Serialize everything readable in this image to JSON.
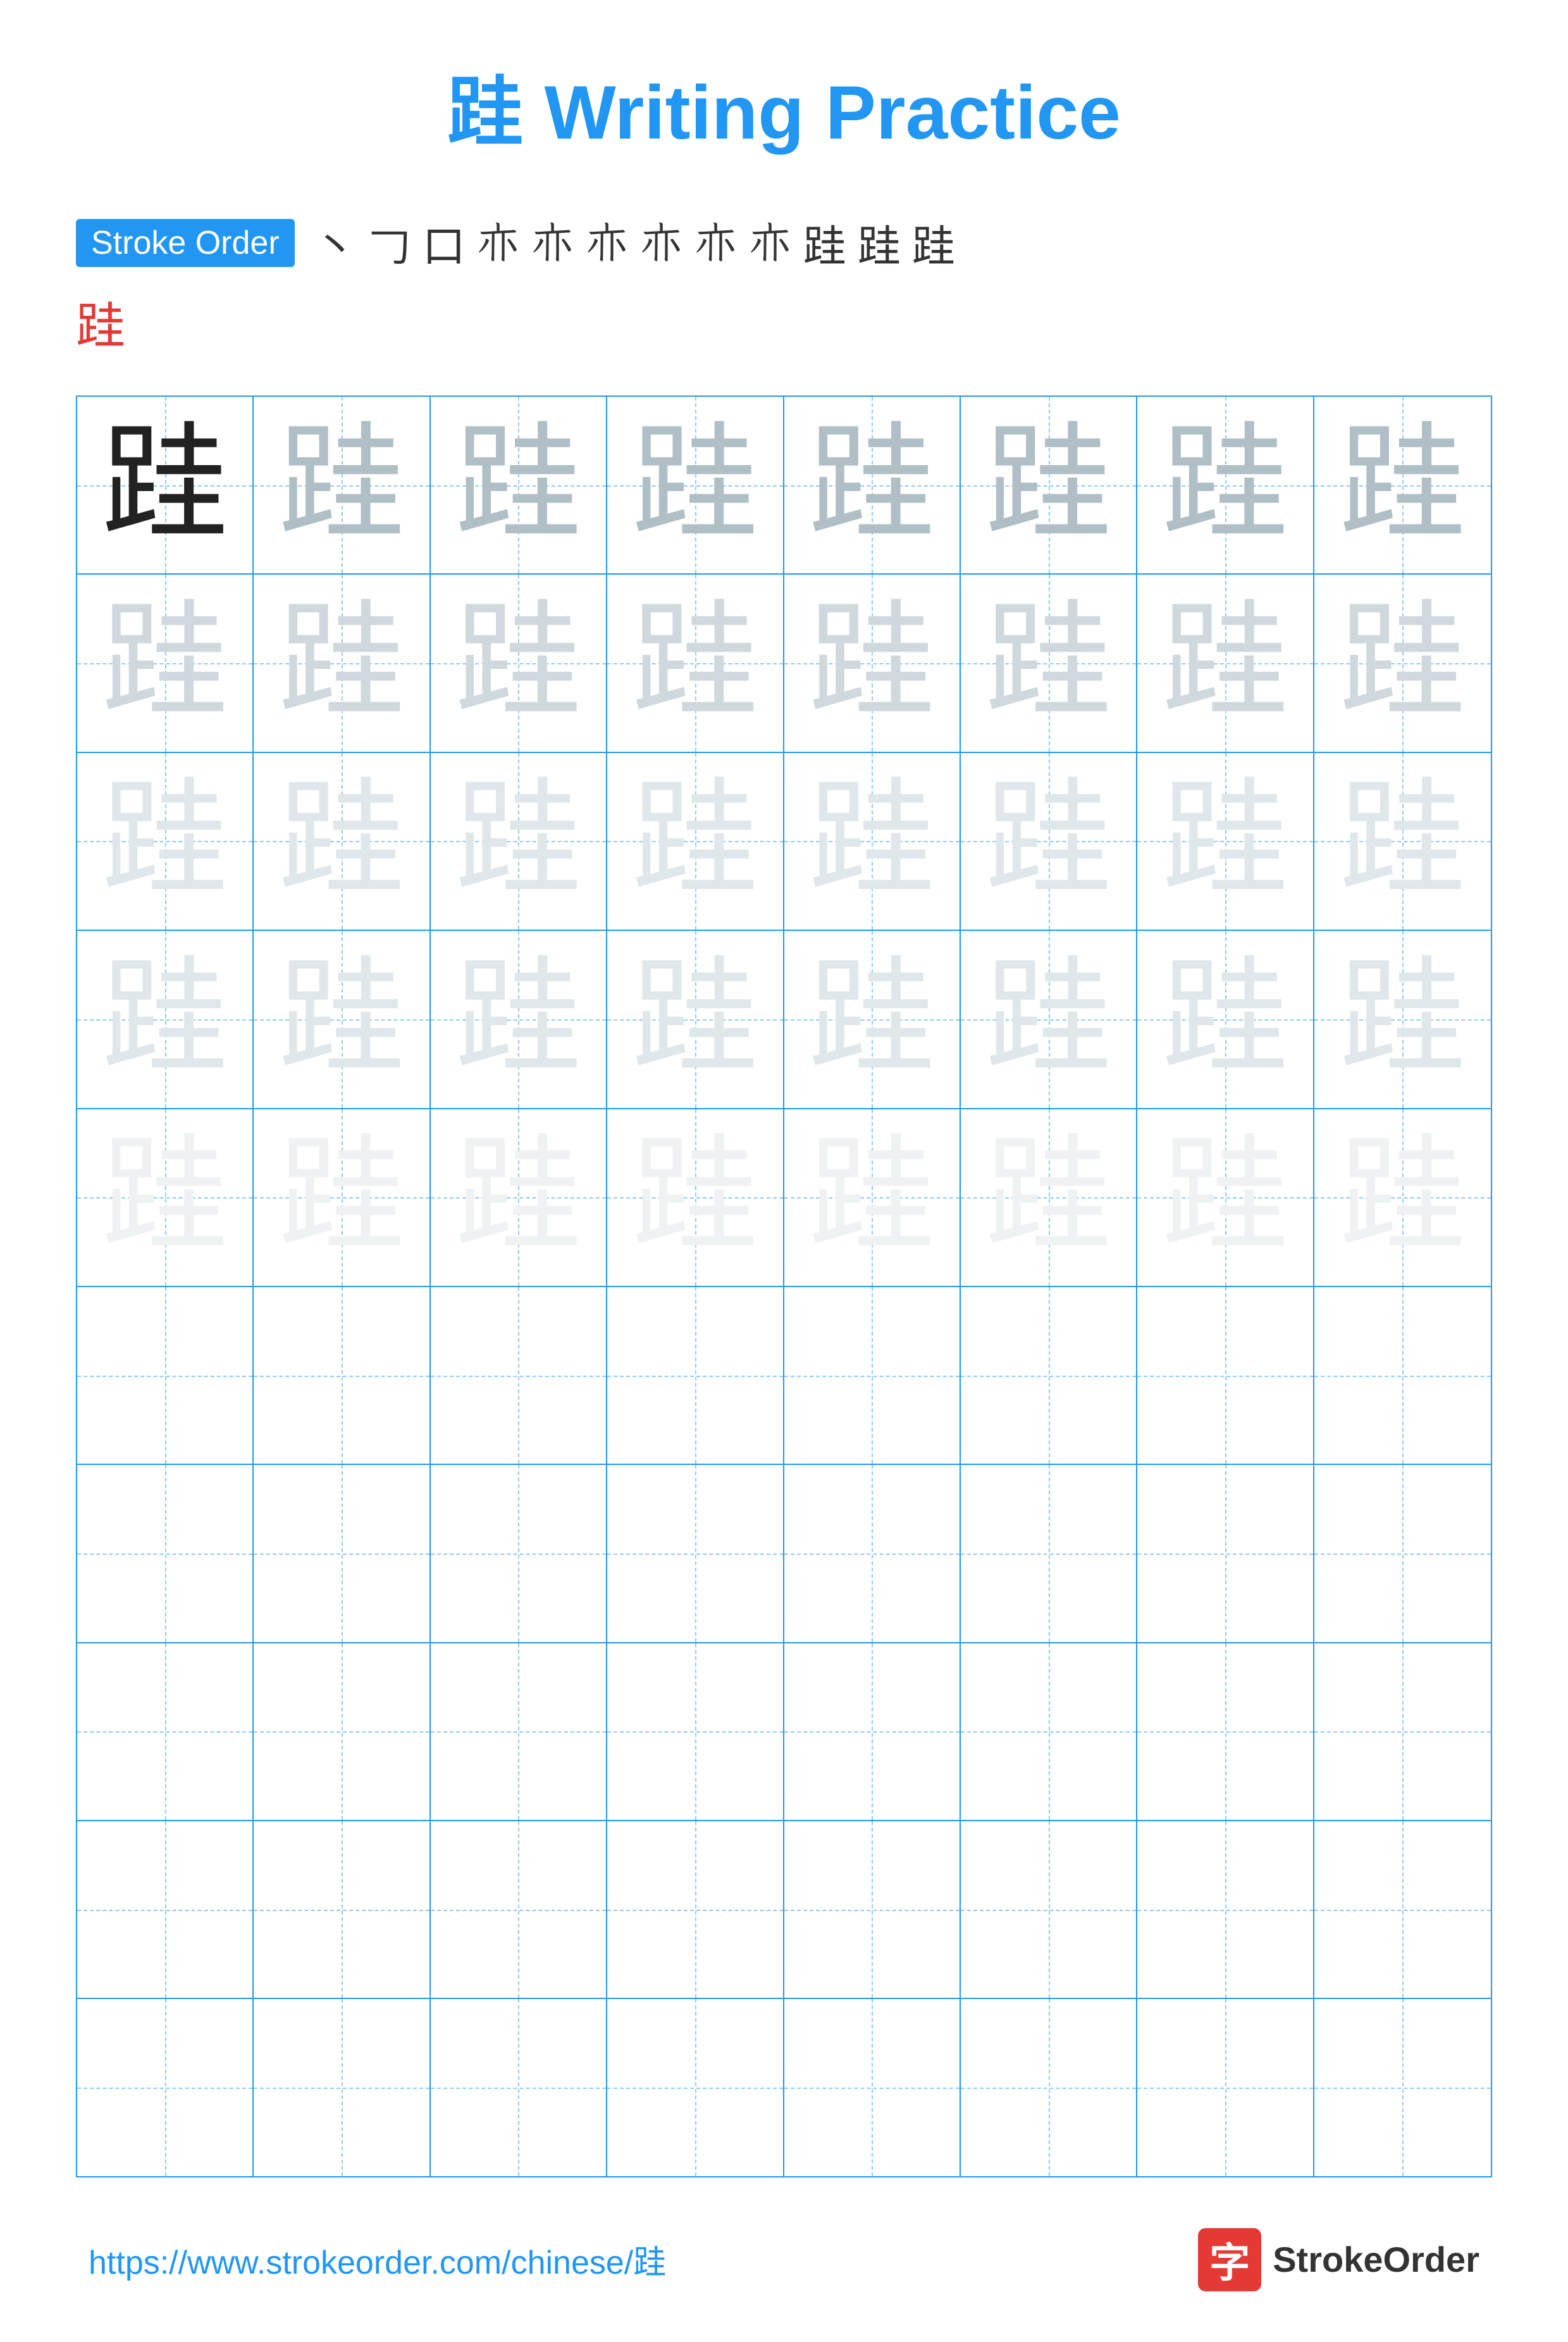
{
  "title": "跬 Writing Practice",
  "stroke_order": {
    "label": "Stroke Order",
    "strokes": [
      "㇀",
      "㇆",
      "口",
      "卝",
      "卝",
      "卝",
      "卝",
      "卝`",
      "卝`",
      "跬",
      "跬",
      "跬"
    ],
    "stroke_chars_display": [
      "丶",
      "ㄱ",
      "口",
      "⺊",
      "⺊",
      "⺊",
      "⺊",
      "⺊",
      "⺊",
      "跬",
      "跬",
      "跬"
    ],
    "final_char": "跬"
  },
  "practice_char": "跬",
  "grid": {
    "rows": 10,
    "cols": 8
  },
  "footer": {
    "url": "https://www.strokeorder.com/chinese/跬",
    "logo_char": "字",
    "brand_name": "StrokeOrder"
  },
  "colors": {
    "primary": "#2196F3",
    "red": "#e53935",
    "dark": "#222222",
    "medium": "#b0bec5",
    "light": "#cfd8dc",
    "lighter": "#e0e7ea",
    "lightest": "#eef2f3"
  }
}
